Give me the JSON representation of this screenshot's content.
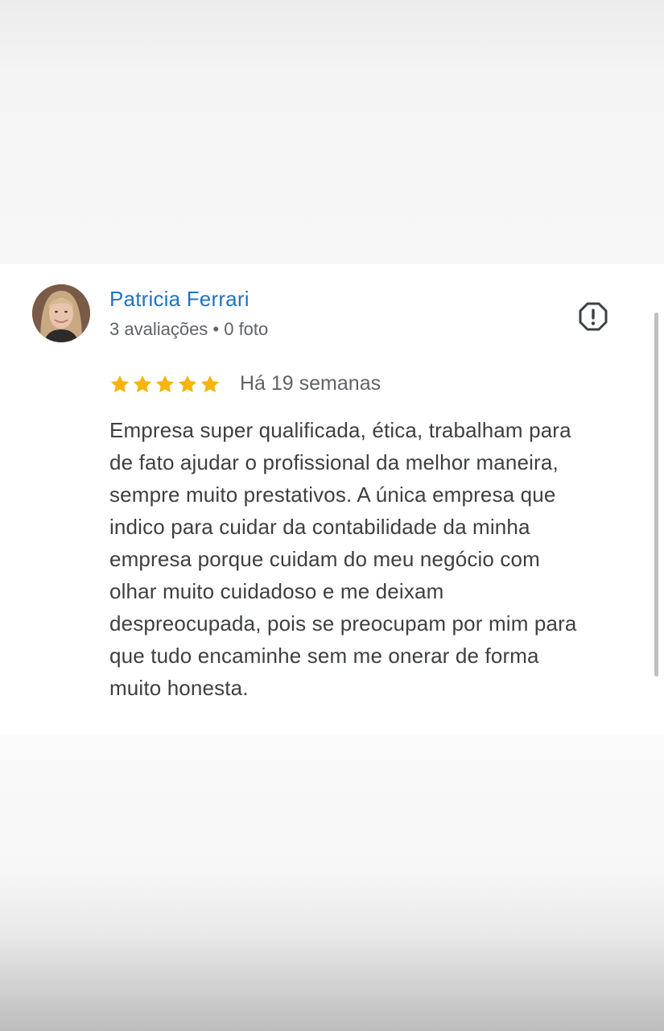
{
  "review": {
    "reviewer_name": "Patricia Ferrari",
    "reviewer_meta": "3 avaliações • 0 foto",
    "rating": 5,
    "rating_max": 5,
    "date": "Há 19 semanas",
    "text_lines": [
      "Empresa super qualificada, ética, trabalham para",
      "de fato ajudar o profissional da melhor maneira,",
      "sempre muito prestativos. A única empresa que",
      "indico para cuidar da contabilidade da minha",
      "empresa porque cuidam do meu negócio com",
      "olhar muito cuidadoso e me deixam",
      "despreocupada, pois se preocupam por mim para",
      "que tudo encaminhe sem me onerar de forma",
      "muito honesta."
    ]
  },
  "icons": {
    "avatar": "avatar-photo",
    "flag": "report-flag-icon",
    "star": "star-icon"
  },
  "colors": {
    "name": "#1e73c7",
    "meta": "#5f6368",
    "text": "#3c4043",
    "star": "#f5b50a",
    "card": "#ffffff"
  }
}
